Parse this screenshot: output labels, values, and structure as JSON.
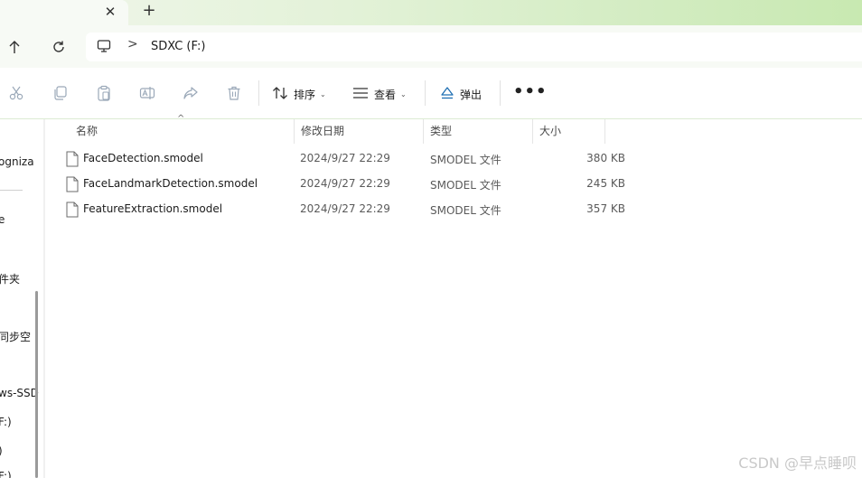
{
  "tabs": {
    "close_glyph": "✕",
    "new_tab_glyph": "+"
  },
  "navigation": {
    "breadcrumb": {
      "separator": ">",
      "location": "SDXC (F:)"
    }
  },
  "toolbar": {
    "sort_label": "排序",
    "view_label": "查看",
    "eject_label": "弹出",
    "more_label": "•••",
    "icons": [
      "cut-icon",
      "copy-icon",
      "paste-icon",
      "rename-icon",
      "share-icon",
      "delete-icon"
    ]
  },
  "sidebar": {
    "items": [
      "ogniza",
      "e",
      "件夹",
      "同步空",
      "ws-SSD",
      "F:)",
      ")",
      "F:)"
    ]
  },
  "file_list": {
    "columns": {
      "name": "名称",
      "modified": "修改日期",
      "type": "类型",
      "size": "大小"
    },
    "sort_indicator": "^",
    "rows": [
      {
        "name": "FaceDetection.smodel",
        "modified": "2024/9/27 22:29",
        "type": "SMODEL 文件",
        "size": "380 KB"
      },
      {
        "name": "FaceLandmarkDetection.smodel",
        "modified": "2024/9/27 22:29",
        "type": "SMODEL 文件",
        "size": "245 KB"
      },
      {
        "name": "FeatureExtraction.smodel",
        "modified": "2024/9/27 22:29",
        "type": "SMODEL 文件",
        "size": "357 KB"
      }
    ]
  },
  "watermark": "CSDN @早点睡呗",
  "colors": {
    "tabstrip_start": "#f1f6ec",
    "tabstrip_end": "#c8e9b1",
    "accent_eject": "#1f6fb3"
  }
}
